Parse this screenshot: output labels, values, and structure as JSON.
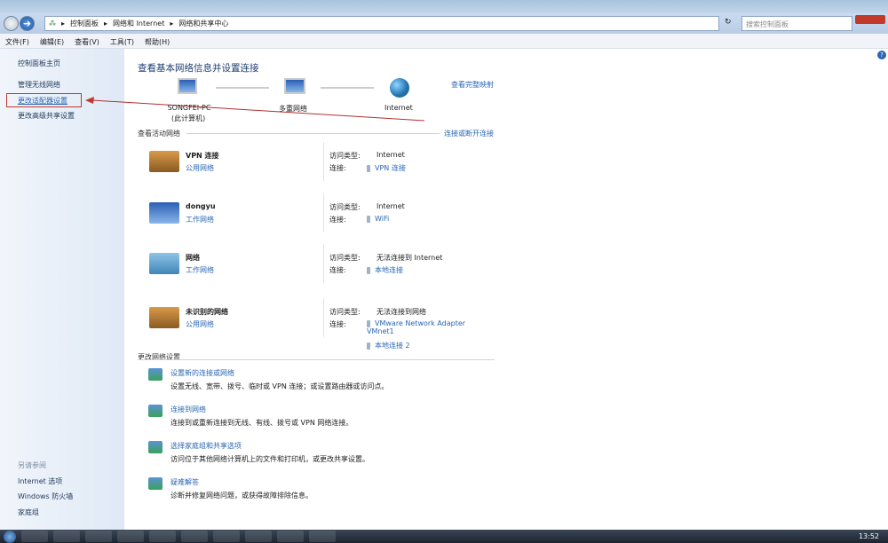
{
  "nav": {
    "breadcrumb": [
      "控制面板",
      "网络和 Internet",
      "网络和共享中心"
    ],
    "search_placeholder": "搜索控制面板"
  },
  "menu": [
    "文件(F)",
    "编辑(E)",
    "查看(V)",
    "工具(T)",
    "帮助(H)"
  ],
  "sidebar": {
    "items": [
      "控制面板主页",
      "管理无线网络",
      "更改适配器设置",
      "更改高级共享设置"
    ],
    "see_also": "另请参阅",
    "see_also_items": [
      "Internet 选项",
      "Windows 防火墙",
      "家庭组"
    ]
  },
  "main": {
    "title": "查看基本网络信息并设置连接",
    "full_map": "查看完整映射",
    "map": {
      "pc": "SONGFEI-PC",
      "pc_sub": "(此计算机)",
      "middle": "多重网络",
      "internet": "Internet"
    },
    "active_title": "查看活动网络",
    "connect_link": "连接或断开连接",
    "access_label": "访问类型:",
    "conn_label": "连接:",
    "networks": [
      {
        "name": "VPN 连接",
        "type": "公用网络",
        "access": "Internet",
        "conns": [
          "VPN 连接"
        ]
      },
      {
        "name": "dongyu",
        "type": "工作网络",
        "access": "Internet",
        "conns": [
          "WiFi"
        ]
      },
      {
        "name": "网络",
        "type": "工作网络",
        "access": "无法连接到 Internet",
        "conns": [
          "本地连接"
        ]
      },
      {
        "name": "未识别的网络",
        "type": "公用网络",
        "access": "无法连接到网络",
        "conns": [
          "VMware Network Adapter VMnet1",
          "本地连接 2"
        ]
      }
    ],
    "change_title": "更改网络设置",
    "tasks": [
      {
        "title": "设置新的连接或网络",
        "desc": "设置无线、宽带、拨号、临时或 VPN 连接；或设置路由器或访问点。"
      },
      {
        "title": "连接到网络",
        "desc": "连接到或重新连接到无线、有线、拨号或 VPN 网络连接。"
      },
      {
        "title": "选择家庭组和共享选项",
        "desc": "访问位于其他网络计算机上的文件和打印机，或更改共享设置。"
      },
      {
        "title": "疑难解答",
        "desc": "诊断并修复网络问题，或获得故障排除信息。"
      }
    ]
  },
  "taskbar": {
    "time": "13:52"
  }
}
